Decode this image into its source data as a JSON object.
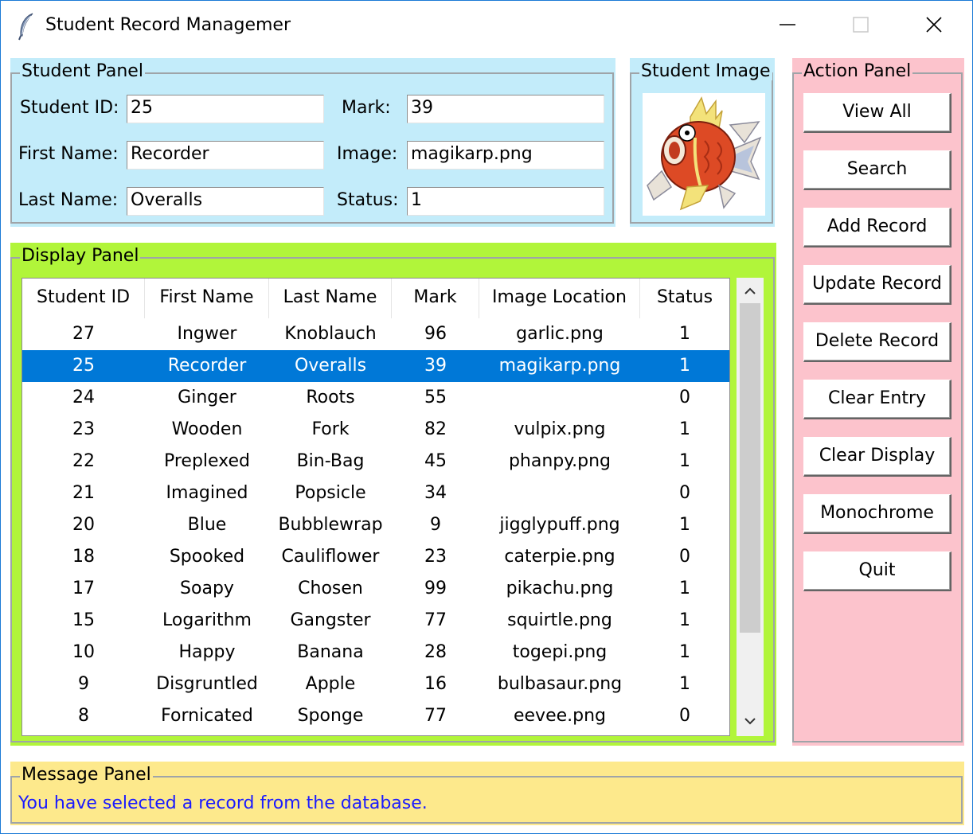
{
  "window": {
    "title": "Student Record Managemer"
  },
  "student_panel": {
    "legend": "Student Panel",
    "student_id_label": "Student ID:",
    "student_id_value": "25",
    "first_name_label": "First Name:",
    "first_name_value": "Recorder",
    "last_name_label": "Last Name:",
    "last_name_value": "Overalls",
    "mark_label": "Mark:",
    "mark_value": "39",
    "image_label": "Image:",
    "image_value": "magikarp.png",
    "status_label": "Status:",
    "status_value": "1"
  },
  "image_panel": {
    "legend": "Student Image"
  },
  "action_panel": {
    "legend": "Action Panel",
    "buttons": [
      "View All",
      "Search",
      "Add Record",
      "Update Record",
      "Delete Record",
      "Clear Entry",
      "Clear Display",
      "Monochrome",
      "Quit"
    ]
  },
  "display_panel": {
    "legend": "Display Panel",
    "columns": [
      "Student ID",
      "First Name",
      "Last Name",
      "Mark",
      "Image Location",
      "Status"
    ],
    "selected_row": 1,
    "rows": [
      [
        "27",
        "Ingwer",
        "Knoblauch",
        "96",
        "garlic.png",
        "1"
      ],
      [
        "25",
        "Recorder",
        "Overalls",
        "39",
        "magikarp.png",
        "1"
      ],
      [
        "24",
        "Ginger",
        "Roots",
        "55",
        "",
        "0"
      ],
      [
        "23",
        "Wooden",
        "Fork",
        "82",
        "vulpix.png",
        "1"
      ],
      [
        "22",
        "Preplexed",
        "Bin-Bag",
        "45",
        "phanpy.png",
        "1"
      ],
      [
        "21",
        "Imagined",
        "Popsicle",
        "34",
        "",
        "0"
      ],
      [
        "20",
        "Blue",
        "Bubblewrap",
        "9",
        "jigglypuff.png",
        "1"
      ],
      [
        "18",
        "Spooked",
        "Cauliflower",
        "23",
        "caterpie.png",
        "0"
      ],
      [
        "17",
        "Soapy",
        "Chosen",
        "99",
        "pikachu.png",
        "1"
      ],
      [
        "15",
        "Logarithm",
        "Gangster",
        "77",
        "squirtle.png",
        "1"
      ],
      [
        "10",
        "Happy",
        "Banana",
        "28",
        "togepi.png",
        "1"
      ],
      [
        "9",
        "Disgruntled",
        "Apple",
        "16",
        "bulbasaur.png",
        "1"
      ],
      [
        "8",
        "Fornicated",
        "Sponge",
        "77",
        "eevee.png",
        "0"
      ]
    ]
  },
  "message_panel": {
    "legend": "Message Panel",
    "message": "You have selected a record from the database."
  },
  "colors": {
    "student_panel_bg": "#c3ecfa",
    "action_panel_bg": "#fcc3cc",
    "display_panel_bg": "#b1f53a",
    "message_panel_bg": "#fde98c",
    "selection": "#0078d7",
    "message_text": "#1a1aff"
  },
  "icons": {
    "app": "feather-icon",
    "minimize": "minimize-icon",
    "maximize": "maximize-icon",
    "close": "close-icon",
    "student_image": "magikarp-image"
  }
}
